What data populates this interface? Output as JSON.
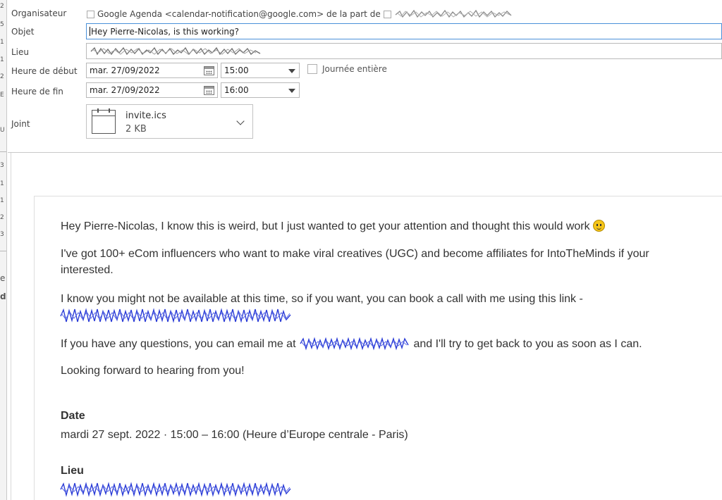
{
  "left_strip_fragments": [
    "2",
    "5",
    "1",
    "1",
    "2",
    "E",
    "U",
    "3",
    "1",
    "1",
    "2",
    "3",
    "e",
    "d"
  ],
  "header": {
    "organizer_label": "Organisateur",
    "organizer_value": "Google Agenda <calendar-notification@google.com> de la part de",
    "subject_label": "Objet",
    "subject_value": "Hey Pierre-Nicolas, is this working?",
    "location_label": "Lieu",
    "start_label": "Heure de début",
    "start_date": "mar. 27/09/2022",
    "start_time": "15:00",
    "all_day_label": "Journée entière",
    "end_label": "Heure de fin",
    "end_date": "mar. 27/09/2022",
    "end_time": "16:00",
    "attachment_label": "Joint",
    "attachment_name": "invite.ics",
    "attachment_size": "2 KB"
  },
  "body": {
    "p1": "Hey Pierre-Nicolas, I know this is weird, but I just wanted to get your attention and thought this would work",
    "p2_line1": "I've got 100+ eCom influencers who want to make viral creatives (UGC) and become affiliates for IntoTheMinds if your",
    "p2_line2": "interested.",
    "p3": "I know you might not be available at this time, so if you want, you can book a call with me using this link -",
    "p4_before": "If you have any questions, you can email me at",
    "p4_after": "and I'll try to get back to you as soon as I can.",
    "p5": "Looking forward to hearing from you!",
    "date_heading": "Date",
    "date_value": "mardi 27 sept. 2022 · 15:00 – 16:00 (Heure d’Europe centrale - Paris)",
    "location_heading": "Lieu"
  },
  "colors": {
    "redaction_blue": "#2a3bd6",
    "redaction_gray": "#8a8a8a",
    "focus_border": "#4a90d9"
  },
  "icons": {
    "calendar_picker": "calendar-icon",
    "dropdown": "triangle-down-icon",
    "attachment": "ics-file-icon",
    "attachment_menu": "chevron-down-icon",
    "emoji": "smiley-icon"
  }
}
